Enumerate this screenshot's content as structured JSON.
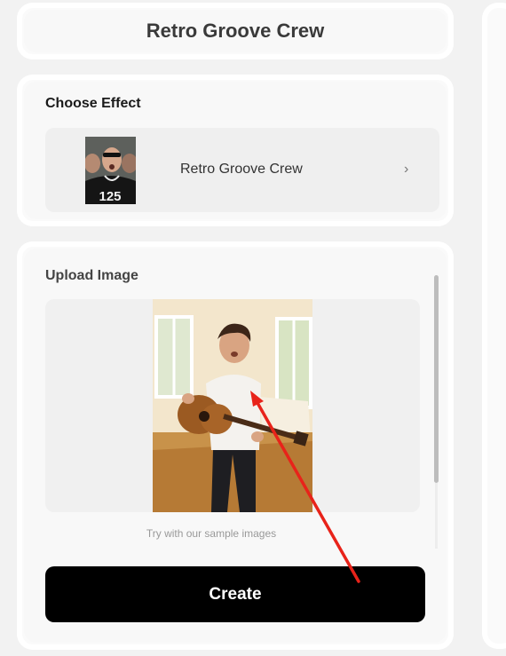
{
  "header": {
    "title": "Retro Groove Crew"
  },
  "effect": {
    "section_label": "Choose Effect",
    "selected_name": "Retro Groove Crew",
    "chevron": "›",
    "thumb_number": "125"
  },
  "upload": {
    "section_label": "Upload Image",
    "sample_hint": "Try with our sample images"
  },
  "actions": {
    "create_label": "Create"
  },
  "colors": {
    "button_bg": "#000000",
    "annotation_arrow": "#e8231a"
  },
  "icons": {
    "chevron": "chevron-right-icon"
  }
}
